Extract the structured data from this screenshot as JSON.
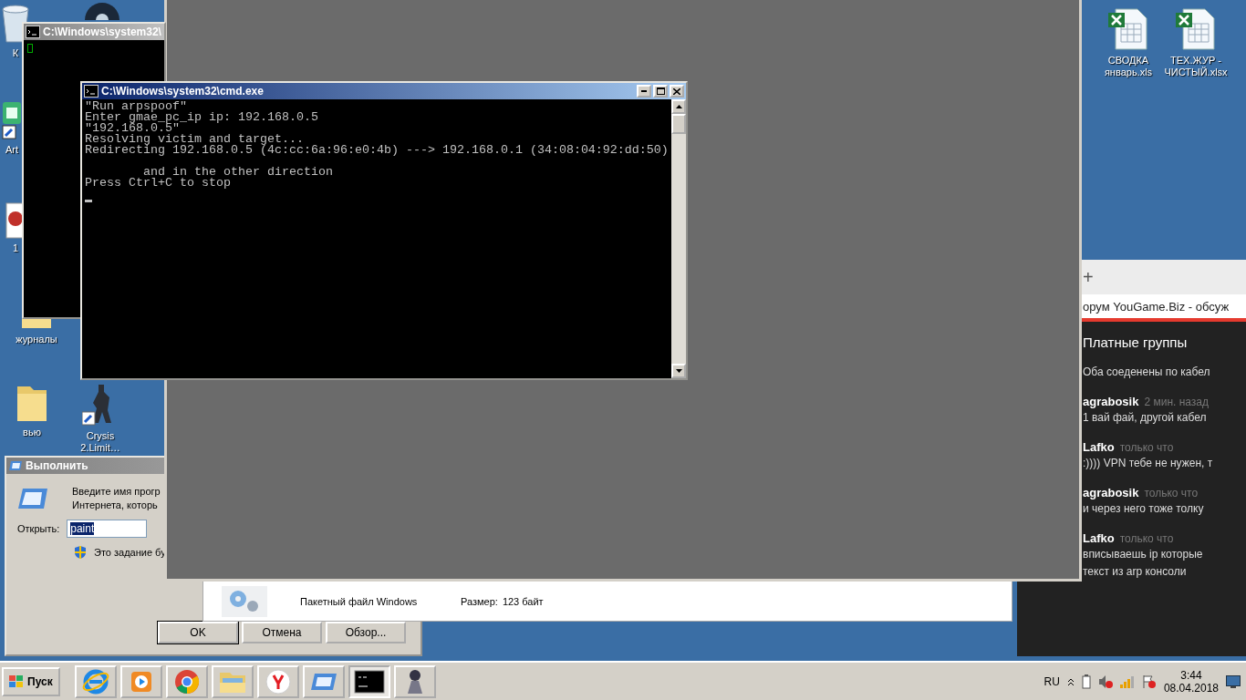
{
  "desktop_icons": [
    {
      "kind": "bin",
      "label": "К"
    },
    {
      "kind": "disc"
    },
    {
      "kind": "app",
      "label": "Art"
    },
    {
      "kind": "image",
      "label": "1"
    },
    {
      "kind": "folder",
      "label": "журналы"
    },
    {
      "kind": "folder",
      "label": "вью"
    },
    {
      "kind": "game",
      "label": "Crysis 2.Limit…"
    },
    {
      "kind": "excel",
      "label": "СВОДКА январь.xls"
    },
    {
      "kind": "excel",
      "label": "ТЕХ.ЖУР - ЧИСТЫЙ.xlsx"
    }
  ],
  "back_console": {
    "title": "C:\\Windows\\system32\\"
  },
  "console": {
    "title": "C:\\Windows\\system32\\cmd.exe",
    "lines": [
      {
        "text": "\"Run arpspoof\"",
        "blank_before": false
      },
      {
        "text": "Enter gmae_pc_ip ip: 192.168.0.5",
        "blank_before": false
      },
      {
        "text": "\"192.168.0.5\"",
        "blank_before": false
      },
      {
        "text": "Resolving victim and target...",
        "blank_before": false
      },
      {
        "text": "Redirecting 192.168.0.5 (4c:cc:6a:96:e0:4b) ---> 192.168.0.1 (34:08:04:92:dd:50)",
        "blank_before": false
      },
      {
        "text": "        and in the other direction",
        "blank_before": true
      },
      {
        "text": "Press Ctrl+C to stop",
        "blank_before": false
      }
    ]
  },
  "run_dialog": {
    "title": "Выполнить",
    "prompt": [
      "Введите имя прогр",
      "Интернета, которь"
    ],
    "open_label": "Открыть:",
    "value": "paint",
    "note": "Это задание бу",
    "buttons": [
      "OK",
      "Отмена",
      "Обзор..."
    ]
  },
  "file_details": {
    "type": "Пакетный файл Windows",
    "size_label": "Размер:",
    "size": "123 байт"
  },
  "browser": {
    "new_tab": "+",
    "address": "орум YouGame.Biz - обсуж",
    "chat_title": "Платные группы",
    "messages": [
      {
        "text": [
          "Оба соеденены по кабел"
        ]
      },
      {
        "author": "agrabosik",
        "time": "2 мин. назад",
        "text": [
          "1 вай фай, другой кабел"
        ]
      },
      {
        "author": "Lafko",
        "time": "только что",
        "text": [
          ":)))) VPN тебе не нужен, т"
        ]
      },
      {
        "author": "agrabosik",
        "time": "только что",
        "text": [
          "и через него тоже толку"
        ]
      },
      {
        "author": "Lafko",
        "time": "только что",
        "text": [
          "вписываешь ip которые",
          "текст из arp консоли"
        ]
      }
    ]
  },
  "taskbar": {
    "start": "Пуск",
    "apps": [
      {
        "kind": "ie",
        "selected": false
      },
      {
        "kind": "media",
        "selected": false
      },
      {
        "kind": "chrome",
        "selected": false
      },
      {
        "kind": "explorer",
        "selected": false
      },
      {
        "kind": "yandex",
        "selected": false
      },
      {
        "kind": "run",
        "selected": false
      },
      {
        "kind": "cmd",
        "selected": true
      },
      {
        "kind": "game",
        "selected": false
      }
    ],
    "language": "RU",
    "time": "3:44",
    "date": "08.04.2018"
  }
}
